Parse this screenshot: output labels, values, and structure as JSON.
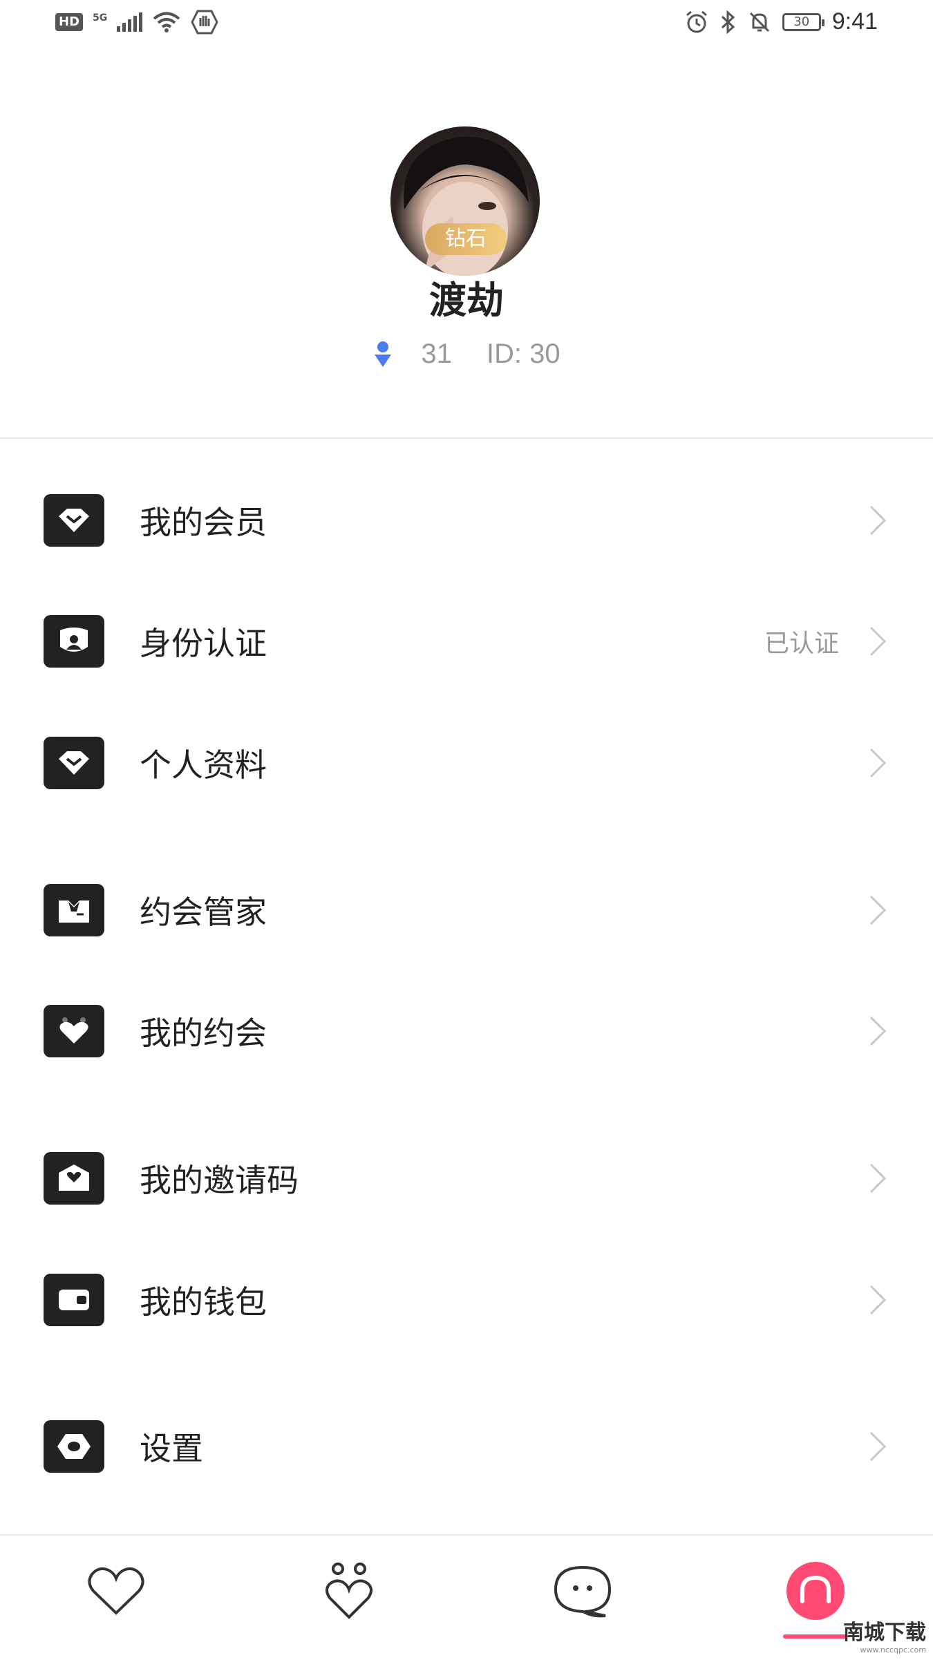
{
  "status_bar": {
    "network_badge": "HD",
    "network_type": "5G",
    "battery_level": "30",
    "time": "9:41"
  },
  "profile": {
    "avatar_badge": "钻石",
    "name": "渡劫",
    "age": "31",
    "id_text": "ID: 30",
    "gender_icon_color": "#4a7bf0"
  },
  "menu": [
    {
      "label": "我的会员",
      "value": "",
      "icon": "diamond-icon"
    },
    {
      "label": "身份认证",
      "value": "已认证",
      "icon": "id-shield-icon"
    },
    {
      "label": "个人资料",
      "value": "",
      "icon": "diamond-icon"
    },
    {
      "label": "约会管家",
      "value": "",
      "icon": "butler-icon"
    },
    {
      "label": "我的约会",
      "value": "",
      "icon": "heart-icon"
    },
    {
      "label": "我的邀请码",
      "value": "",
      "icon": "invite-envelope-icon"
    },
    {
      "label": "我的钱包",
      "value": "",
      "icon": "wallet-icon"
    },
    {
      "label": "设置",
      "value": "",
      "icon": "settings-icon"
    }
  ],
  "tabbar": {
    "tabs": [
      "heart-tab-icon",
      "match-tab-icon",
      "message-tab-icon",
      "profile-tab-icon"
    ],
    "active_color": "#ff4a73"
  },
  "watermark": {
    "title": "南城下载",
    "url": "www.nccqpc.com"
  }
}
